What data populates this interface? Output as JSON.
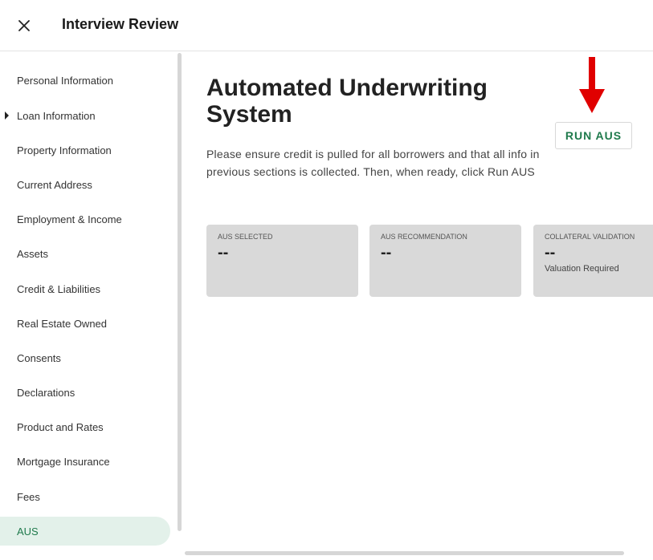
{
  "header": {
    "title": "Interview Review",
    "close_icon": "close-icon"
  },
  "sidebar": {
    "active_color": "#1f7a4c",
    "items": [
      {
        "label": "Personal Information"
      },
      {
        "label": "Loan Information",
        "expandable": true
      },
      {
        "label": "Property Information"
      },
      {
        "label": "Current Address"
      },
      {
        "label": "Employment & Income"
      },
      {
        "label": "Assets"
      },
      {
        "label": "Credit & Liabilities"
      },
      {
        "label": "Real Estate Owned"
      },
      {
        "label": "Consents"
      },
      {
        "label": "Declarations"
      },
      {
        "label": "Product and Rates"
      },
      {
        "label": "Mortgage Insurance"
      },
      {
        "label": "Fees"
      },
      {
        "label": "AUS",
        "active": true
      }
    ]
  },
  "main": {
    "title": "Automated Underwriting System",
    "description": "Please ensure credit is pulled for all borrowers and that all info in previous sections is collected. Then, when ready, click Run AUS",
    "run_button_label": "RUN AUS",
    "annotation_arrow_color": "#e00000",
    "cards": [
      {
        "label": "AUS SELECTED",
        "value": "--"
      },
      {
        "label": "AUS RECOMMENDATION",
        "value": "--"
      },
      {
        "label": "COLLATERAL VALIDATION",
        "value": "--",
        "sub": "Valuation Required"
      }
    ]
  }
}
